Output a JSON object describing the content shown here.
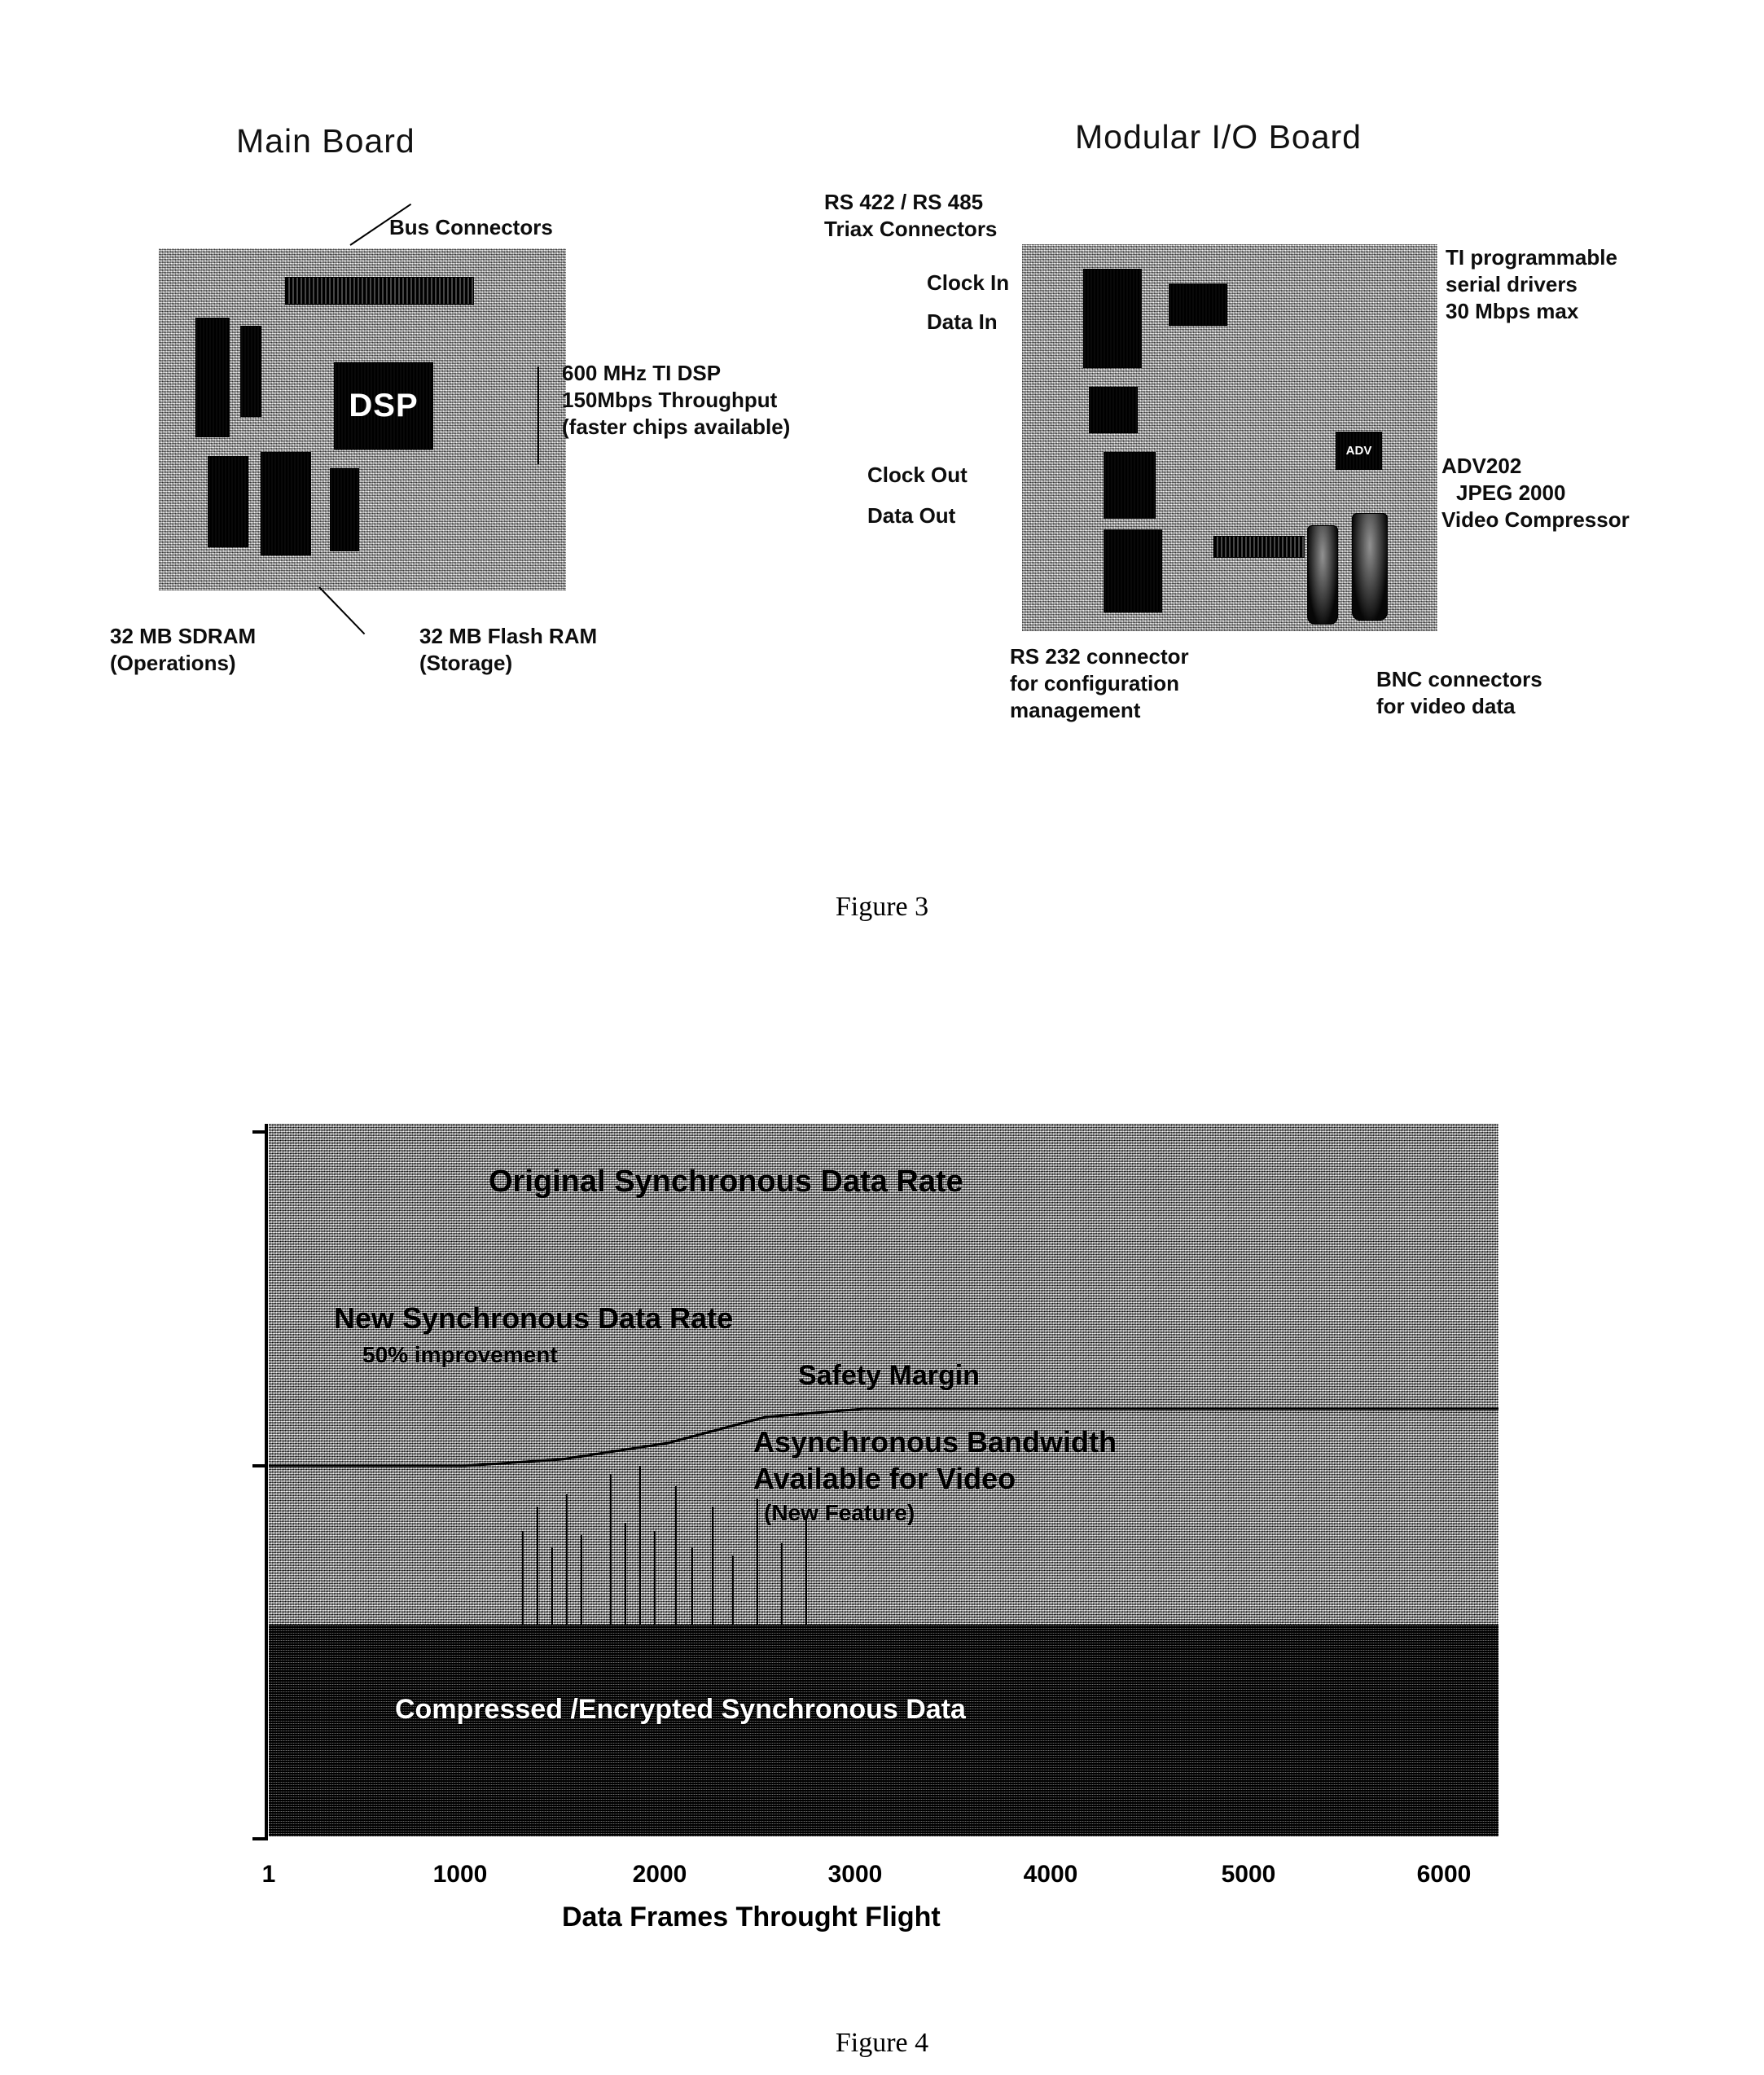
{
  "page": {
    "figure3_caption": "Figure 3",
    "figure4_caption": "Figure 4"
  },
  "figure3": {
    "main_board": {
      "title": "Main Board",
      "chip_label": "DSP",
      "callouts": {
        "bus_connectors": "Bus Connectors",
        "dsp_line1": "600 MHz TI DSP",
        "dsp_line2": "150Mbps Throughput",
        "dsp_line3": "(faster chips available)",
        "sdram_line1": "32 MB SDRAM",
        "sdram_line2": "(Operations)",
        "flash_line1": "32 MB Flash RAM",
        "flash_line2": "(Storage)"
      }
    },
    "io_board": {
      "title": "Modular  I/O Board",
      "chip_label": "ADV",
      "callouts": {
        "triax_line1": "RS 422 / RS 485",
        "triax_line2": "Triax Connectors",
        "clock_in": "Clock In",
        "data_in": "Data  In",
        "clock_out": "Clock Out",
        "data_out": "Data  Out",
        "serial_line1": "TI programmable",
        "serial_line2": "serial drivers",
        "serial_line3": "30 Mbps max",
        "adv_line1": "ADV202",
        "adv_line2": "JPEG 2000",
        "adv_line3": "Video Compressor",
        "rs232_line1": "RS 232 connector",
        "rs232_line2": "for configuration",
        "rs232_line3": "management",
        "bnc_line1": "BNC connectors",
        "bnc_line2": "for video data"
      }
    }
  },
  "chart_data": {
    "type": "area",
    "title": "",
    "xlabel": "Data Frames Throught Flight",
    "ylabel": "",
    "x_ticks": [
      "1",
      "1000",
      "2000",
      "3000",
      "4000",
      "5000",
      "6000"
    ],
    "x_tick_values": [
      1,
      1000,
      2000,
      3000,
      4000,
      5000,
      6000
    ],
    "xlim": [
      1,
      6200
    ],
    "ylim": [
      0,
      100
    ],
    "grid": false,
    "legend_position": "in-plot annotations",
    "annotations": [
      {
        "text": "Original Synchronous Data Rate",
        "role": "region-label-top"
      },
      {
        "text": "New Synchronous Data Rate",
        "role": "region-label"
      },
      {
        "text": "50% improvement",
        "role": "region-sublabel"
      },
      {
        "text": "Safety Margin",
        "role": "region-label"
      },
      {
        "text": "Asynchronous Bandwidth",
        "role": "region-label"
      },
      {
        "text": "Available for Video",
        "role": "region-label"
      },
      {
        "text": "(New Feature)",
        "role": "region-sublabel"
      },
      {
        "text": "Compressed /Encrypted Synchronous Data",
        "role": "band-label-bottom"
      }
    ],
    "series": [
      {
        "name": "Compressed / Encrypted Synchronous Data",
        "type": "area",
        "x": [
          1,
          1000,
          2000,
          3000,
          4000,
          5000,
          6000,
          6200
        ],
        "values": [
          30,
          30,
          30,
          30,
          30,
          30,
          30,
          30
        ]
      },
      {
        "name": "Safety Margin boundary",
        "type": "line",
        "x": [
          1,
          1000,
          1500,
          2000,
          2500,
          3000,
          6200
        ],
        "values": [
          52,
          52,
          53,
          55,
          58,
          60,
          60
        ]
      }
    ],
    "y_marker_values": [
      52
    ]
  }
}
